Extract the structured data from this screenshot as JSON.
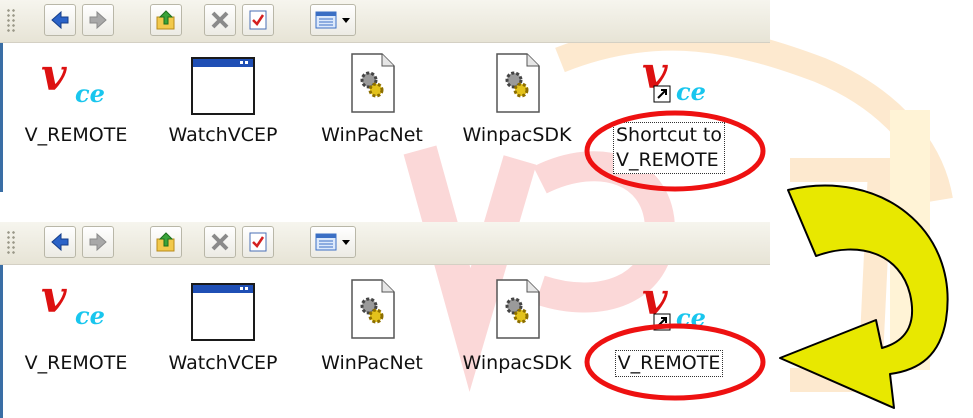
{
  "top_panel": {
    "icons": [
      {
        "label": "V_REMOTE",
        "icon": "vce-logo-icon"
      },
      {
        "label": "WatchVCEP",
        "icon": "window-icon"
      },
      {
        "label": "WinPacNet",
        "icon": "gear-file-icon"
      },
      {
        "label": "WinpacSDK",
        "icon": "gear-file-icon"
      },
      {
        "label_line1": "Shortcut to",
        "label_line2": "V_REMOTE",
        "icon": "vce-shortcut-icon"
      }
    ]
  },
  "bottom_panel": {
    "icons": [
      {
        "label": "V_REMOTE",
        "icon": "vce-logo-icon"
      },
      {
        "label": "WatchVCEP",
        "icon": "window-icon"
      },
      {
        "label": "WinPacNet",
        "icon": "gear-file-icon"
      },
      {
        "label": "WinpacSDK",
        "icon": "gear-file-icon"
      },
      {
        "label": "V_REMOTE",
        "icon": "vce-shortcut-icon"
      }
    ]
  },
  "colors": {
    "highlight_circle": "#ee1111",
    "arrow_fill": "#e8e800",
    "vce_red": "#dd1111",
    "vce_cyan": "#19c6ee",
    "toolbar_bg": "#ecebe2"
  }
}
